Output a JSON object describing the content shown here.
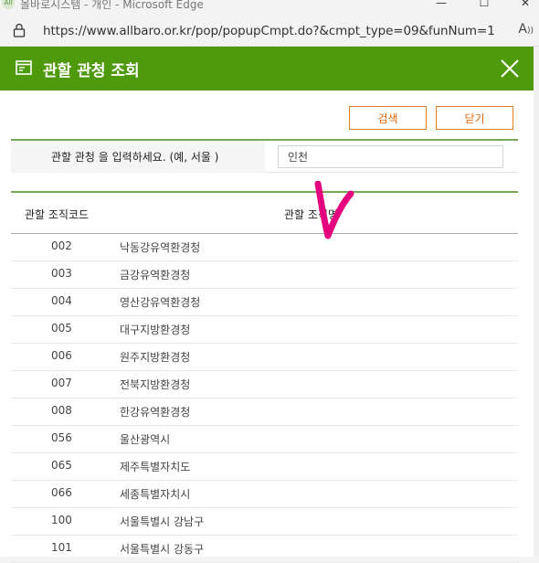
{
  "browser": {
    "logo_text": "All",
    "window_title": "올바로시스템 - 개인 - Microsoft Edge",
    "controls": {
      "minimize": "—",
      "maximize": "☐",
      "close": "✕"
    },
    "url": "https://www.allbaro.or.kr/pop/popupCmpt.do?&cmpt_type=09&funNum=1",
    "reader_label": "A",
    "icons": [
      "lock-icon",
      "read-aloud-icon"
    ]
  },
  "popup": {
    "title": "관할 관청 조회",
    "icon": "popup-window-icon",
    "header_color": "#4f9a0c"
  },
  "toolbar": {
    "search_label": "검색",
    "close_label": "닫기",
    "button_color": "#e0801f"
  },
  "search": {
    "label": "관할 관청 을 입력하세요. (예, 서울 )",
    "value": "인천"
  },
  "table": {
    "headers": {
      "code": "관할 조직코드",
      "name": "관할 조직명"
    },
    "rows": [
      {
        "code": "002",
        "name": "낙동강유역환경청"
      },
      {
        "code": "003",
        "name": "금강유역환경청"
      },
      {
        "code": "004",
        "name": "영산강유역환경청"
      },
      {
        "code": "005",
        "name": "대구지방환경청"
      },
      {
        "code": "006",
        "name": "원주지방환경청"
      },
      {
        "code": "007",
        "name": "전북지방환경청"
      },
      {
        "code": "008",
        "name": "한강유역환경청"
      },
      {
        "code": "056",
        "name": "울산광역시"
      },
      {
        "code": "065",
        "name": "제주특별자치도"
      },
      {
        "code": "066",
        "name": "세종특별자치시"
      },
      {
        "code": "100",
        "name": "서울특별시 강남구"
      },
      {
        "code": "101",
        "name": "서울특별시 강동구"
      }
    ]
  },
  "annotation": {
    "shape": "check-mark",
    "color": "#e5007e"
  }
}
